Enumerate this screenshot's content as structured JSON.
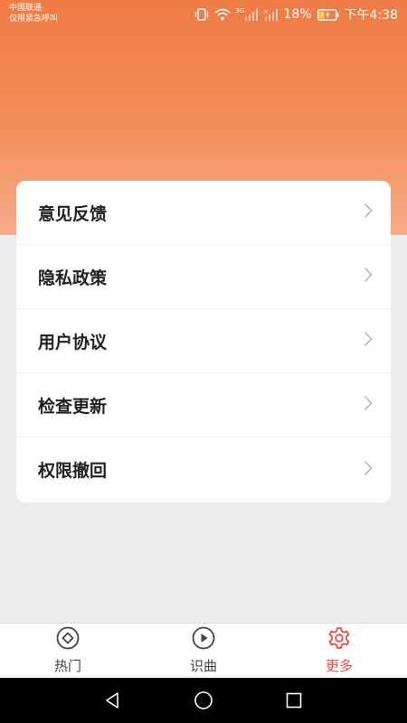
{
  "status_bar": {
    "carrier_line1": "中国联通",
    "carrier_line2": "仅限紧急呼叫",
    "network": "3G",
    "battery": "18%",
    "time": "下午4:38"
  },
  "menu": {
    "items": [
      {
        "label": "意见反馈",
        "icon": "chevron-right-icon"
      },
      {
        "label": "隐私政策",
        "icon": "chevron-right-icon"
      },
      {
        "label": "用户协议",
        "icon": "chevron-right-icon"
      },
      {
        "label": "检查更新",
        "icon": "chevron-right-icon"
      },
      {
        "label": "权限撤回",
        "icon": "chevron-right-icon"
      }
    ]
  },
  "tabs": [
    {
      "label": "热门",
      "icon": "compass-icon",
      "active": false
    },
    {
      "label": "识曲",
      "icon": "play-circle-icon",
      "active": false
    },
    {
      "label": "更多",
      "icon": "gear-icon",
      "active": true
    }
  ],
  "colors": {
    "header_gradient_top": "#f07a44",
    "header_gradient_bottom": "#f6ad88",
    "accent_active": "#e84e3a",
    "page_background": "#ececec"
  },
  "system_nav": {
    "icons": [
      "back-icon",
      "home-icon",
      "recents-icon"
    ]
  }
}
